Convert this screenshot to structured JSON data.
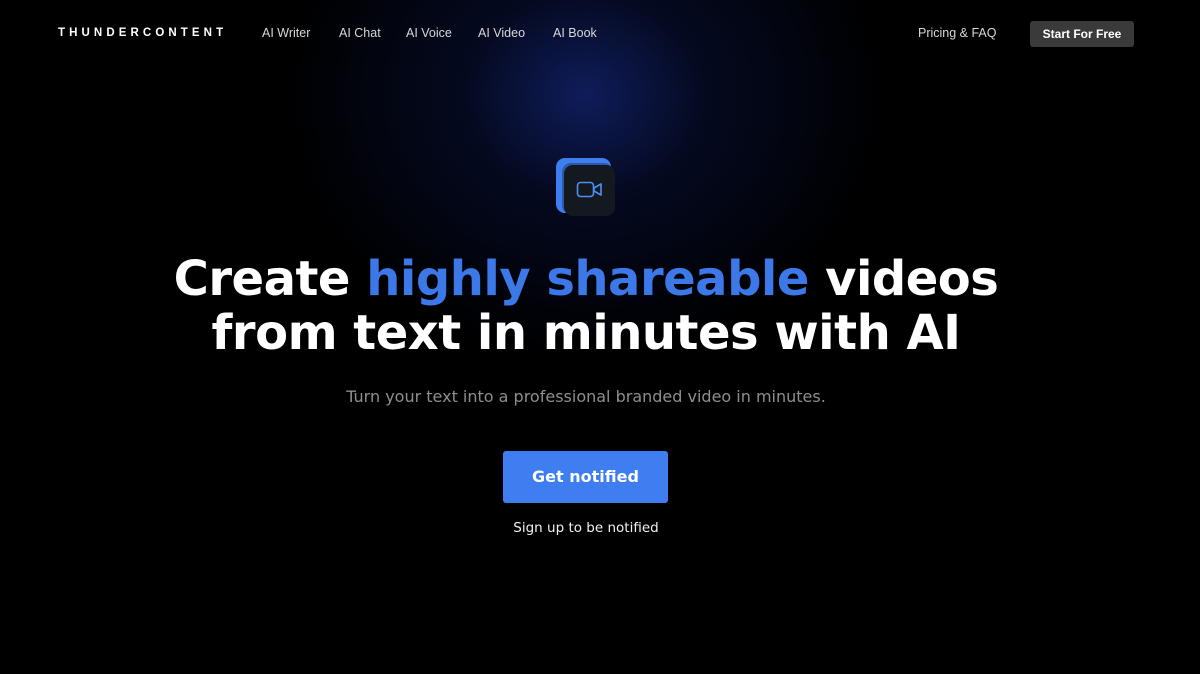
{
  "header": {
    "logo": "THUNDERCONTENT",
    "nav": [
      {
        "label": "AI Writer"
      },
      {
        "label": "AI Chat"
      },
      {
        "label": "AI Voice"
      },
      {
        "label": "AI Video"
      },
      {
        "label": "AI Book"
      }
    ],
    "pricing_label": "Pricing & FAQ",
    "start_label": "Start For Free"
  },
  "hero": {
    "icon": "video-camera-icon",
    "title_part1": "Create ",
    "title_highlight": "highly shareable",
    "title_part2": " videos",
    "title_line2": "from text in minutes with AI",
    "subtitle": "Turn your text into a professional branded video in minutes.",
    "cta_label": "Get notified",
    "cta_note": "Sign up to be notified"
  },
  "colors": {
    "background": "#000000",
    "accent": "#3c78e8",
    "button": "#3e7ef0",
    "start_button": "#3a3a3a"
  }
}
